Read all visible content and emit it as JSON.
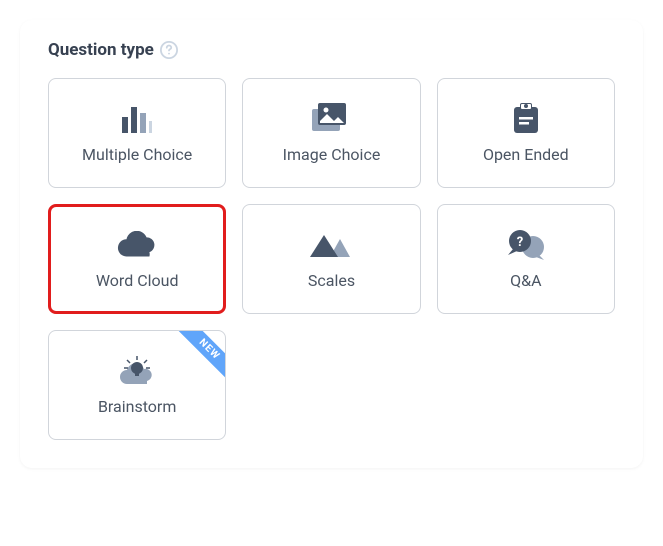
{
  "header": {
    "title": "Question type"
  },
  "options": {
    "multiple_choice": {
      "label": "Multiple Choice"
    },
    "image_choice": {
      "label": "Image Choice"
    },
    "open_ended": {
      "label": "Open Ended"
    },
    "word_cloud": {
      "label": "Word Cloud"
    },
    "scales": {
      "label": "Scales"
    },
    "qa": {
      "label": "Q&A"
    },
    "brainstorm": {
      "label": "Brainstorm",
      "badge": "NEW"
    }
  },
  "selected": "word_cloud",
  "colors": {
    "icon_dark": "#475569",
    "icon_light": "#94a3b8",
    "selected_border": "#e11d1d",
    "ribbon": "#60a5fa"
  }
}
